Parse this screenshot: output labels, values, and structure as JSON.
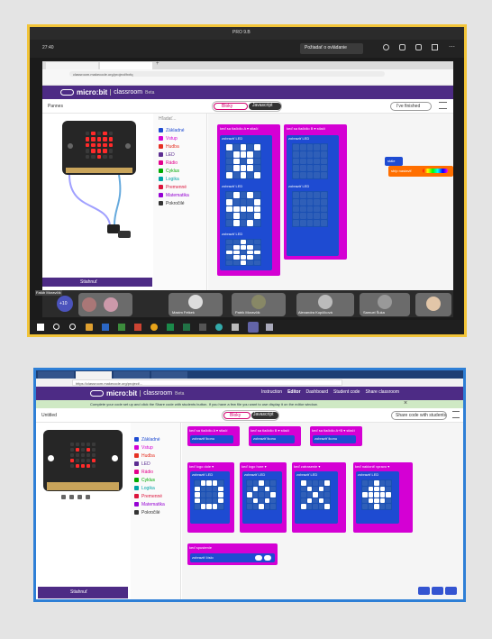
{
  "meeting": {
    "window_title": "PRO 9.B",
    "time": "27:40",
    "request_control": "Požiadať o ovládanie",
    "participants": [
      {
        "name": "Fatúb Moravčík",
        "pinned": true
      },
      {
        "name": "Maxim Fetkek",
        "pinned": true
      },
      {
        "name": "Patrik Moravčík",
        "pinned": true
      },
      {
        "name": "Alexandra Kupčíková",
        "pinned": true
      },
      {
        "name": "Samuel Šuka",
        "pinned": true
      }
    ],
    "extra_count": "+10"
  },
  "shot1": {
    "url": "classroom.makecode.org/project/hxfq",
    "brand": "micro:bit",
    "app": "classroom",
    "app_suffix": "Beta",
    "project": "Pannes",
    "tab_blocks": "Bloky",
    "tab_js": "Javascript",
    "finished": "I've finished",
    "search": "Hľadať...",
    "toolbox": [
      {
        "label": "Základné",
        "color": "#1e4bd2"
      },
      {
        "label": "Vstup",
        "color": "#d400d4"
      },
      {
        "label": "Hudba",
        "color": "#e63022"
      },
      {
        "label": "LED",
        "color": "#5c2d91"
      },
      {
        "label": "Rádio",
        "color": "#e3008c"
      },
      {
        "label": "Cyklus",
        "color": "#00aa00"
      },
      {
        "label": "Logika",
        "color": "#00a4a6"
      },
      {
        "label": "Premenné",
        "color": "#dc143c"
      },
      {
        "label": "Matematika",
        "color": "#9400d3"
      },
      {
        "label": "Pokročilé",
        "color": "#333333"
      }
    ],
    "hat1": "keď sa tlačidlo A ▾ stlačí",
    "hat2": "keď sa tlačidlo B ▾ stlačí",
    "show_led": "zobraziť LED",
    "forever": "stále",
    "color_block": "strip nastaviť",
    "save": "Stiahnuť"
  },
  "shot2": {
    "url": "https://classroom.makecode.org/project/...",
    "brand": "micro:bit",
    "app": "classroom",
    "app_suffix": "Beta",
    "nav": [
      "Instruction",
      "Editor",
      "Dashboard",
      "Student code",
      "Share classroom"
    ],
    "notice": "Complete your code set up and click the Share code with students button. If you have a few file you want to use display it on the editor window.",
    "project": "Untitled",
    "tab_blocks": "Bloky",
    "tab_js": "Javascript",
    "share": "Share code with students",
    "toolbox": [
      {
        "label": "Základné",
        "color": "#1e4bd2"
      },
      {
        "label": "Vstup",
        "color": "#d400d4"
      },
      {
        "label": "Hudba",
        "color": "#e63022"
      },
      {
        "label": "LED",
        "color": "#5c2d91"
      },
      {
        "label": "Rádio",
        "color": "#e3008c"
      },
      {
        "label": "Cyklus",
        "color": "#00aa00"
      },
      {
        "label": "Logika",
        "color": "#00a4a6"
      },
      {
        "label": "Premenné",
        "color": "#dc143c"
      },
      {
        "label": "Matematika",
        "color": "#9400d3"
      },
      {
        "label": "Pokročilé",
        "color": "#333333"
      }
    ],
    "hats": [
      "keď sa tlačidlo A ▾ stlačí",
      "keď sa tlačidlo B ▾ stlačí",
      "keď sa tlačidlo A+B ▾ stlačí"
    ],
    "hats2": [
      "keď logo dole ▾",
      "keď logo hore ▾",
      "keď zatrasenie ▾",
      "keď nakloniť vpravo ▾"
    ],
    "show_icon": "zobraziť ikonu",
    "show_led": "zobraziť LED",
    "start": "keď spustenie",
    "start_body": "zobraziť číslo",
    "save": "Stiahnuť"
  },
  "colors": {
    "mb_purple": "#4d2b85",
    "block_blue": "#1e4bd2",
    "block_magenta": "#c020c0",
    "orange": "#ff6f00"
  }
}
